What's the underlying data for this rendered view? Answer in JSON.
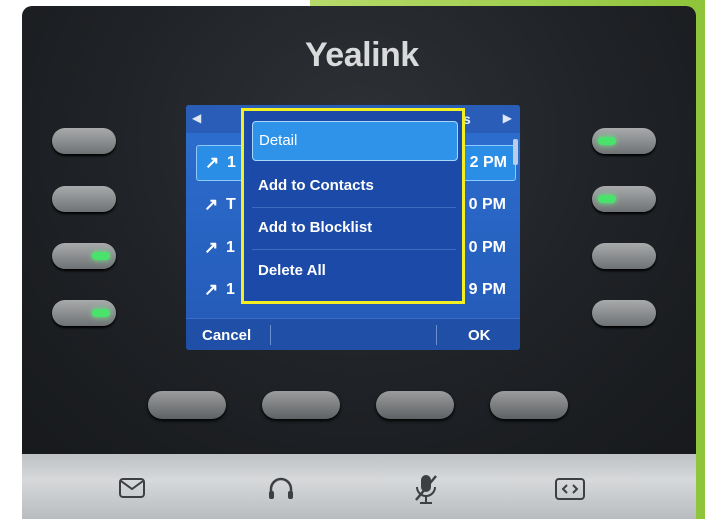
{
  "brand": "Yealink",
  "lcd": {
    "title_fragment": "s",
    "rows": [
      {
        "icon": "↗",
        "name": "1",
        "time": "2 PM",
        "selected": true
      },
      {
        "icon": "↗",
        "name": "T",
        "time": "0 PM",
        "selected": false
      },
      {
        "icon": "↗",
        "name": "1",
        "time": "0 PM",
        "selected": false
      },
      {
        "icon": "↗",
        "name": "1",
        "time": "9 PM",
        "selected": false
      }
    ],
    "softkeys": {
      "left": "Cancel",
      "right": "OK"
    }
  },
  "popup": {
    "items": [
      "Detail",
      "Add to Contacts",
      "Add to Blocklist",
      "Delete All"
    ],
    "highlight_color": "#f4ef22"
  },
  "icons": {
    "message": "envelope-icon",
    "headset": "headset-icon",
    "mute": "mic-mute-icon",
    "transfer": "brackets-icon"
  },
  "colors": {
    "led": "#49e36c",
    "screen": "#2459b6"
  }
}
